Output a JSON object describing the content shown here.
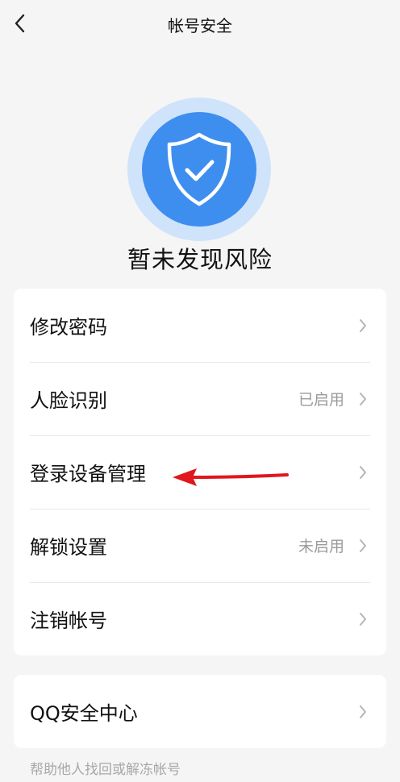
{
  "nav": {
    "title": "帐号安全"
  },
  "status": {
    "text": "暂未发现风险"
  },
  "menu": {
    "items": [
      {
        "label": "修改密码",
        "value": ""
      },
      {
        "label": "人脸识别",
        "value": "已启用"
      },
      {
        "label": "登录设备管理",
        "value": ""
      },
      {
        "label": "解锁设置",
        "value": "未启用"
      },
      {
        "label": "注销帐号",
        "value": ""
      }
    ]
  },
  "qq_center": {
    "label": "QQ安全中心"
  },
  "footer": {
    "text": "帮助他人找回或解冻帐号"
  },
  "colors": {
    "shield_outer": "#cfe3fb",
    "shield_inner": "#3e8ef0",
    "annotation_arrow": "#e0171d"
  },
  "icons": {
    "back": "chevron-left-icon",
    "shield": "shield-check-icon",
    "row_arrow": "chevron-right-icon"
  }
}
